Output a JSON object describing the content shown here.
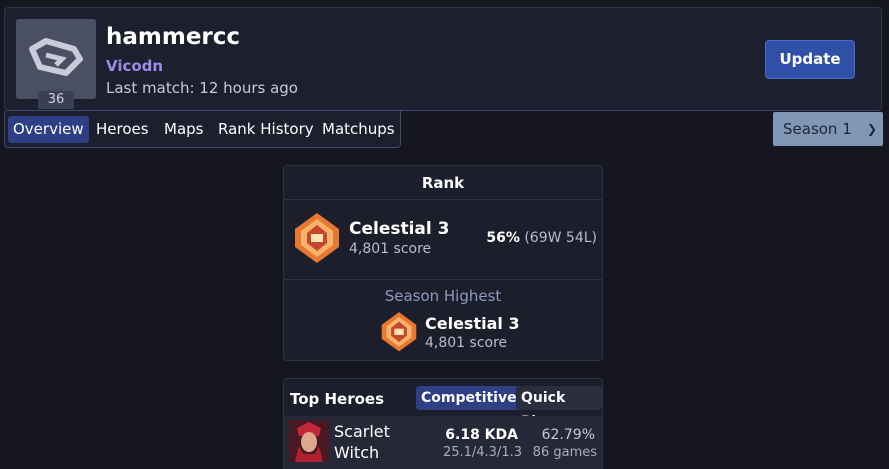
{
  "profile": {
    "username": "hammercc",
    "club": "Vicodn",
    "last_match": "Last match: 12 hours ago",
    "level": "36",
    "update_label": "Update"
  },
  "tabs": [
    {
      "label": "Overview",
      "active": true
    },
    {
      "label": "Heroes",
      "active": false
    },
    {
      "label": "Maps",
      "active": false
    },
    {
      "label": "Rank History",
      "active": false
    },
    {
      "label": "Matchups",
      "active": false
    }
  ],
  "season_select": {
    "value": "Season 1",
    "icon": "chevron-down-icon"
  },
  "rank": {
    "title": "Rank",
    "current_name": "Celestial 3",
    "current_score": "4,801 score",
    "winrate_pct": "56%",
    "winrate_record": "(69W 54L)",
    "season_highest_label": "Season Highest",
    "highest_name": "Celestial 3",
    "highest_score": "4,801 score"
  },
  "top_heroes": {
    "title": "Top Heroes",
    "modes": [
      {
        "label": "Competitive",
        "active": true
      },
      {
        "label": "Quick Play",
        "active": false
      }
    ],
    "heroes": [
      {
        "name": "Scarlet Witch",
        "kda": "6.18 KDA",
        "kda_detail": "25.1/4.3/1.3",
        "winrate": "62.79%",
        "games": "86 games"
      }
    ]
  },
  "colors": {
    "accent": "#2e3f86",
    "button": "#3050a8",
    "club": "#9d8bea",
    "rank_orange": "#e8782f"
  }
}
